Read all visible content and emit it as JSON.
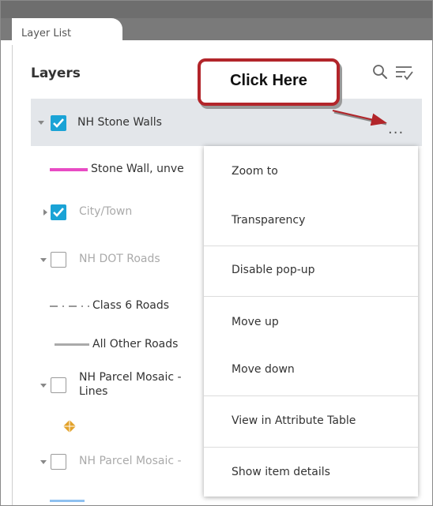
{
  "tab": {
    "label": "Layer List"
  },
  "header": {
    "title": "Layers"
  },
  "callout": {
    "text": "Click Here"
  },
  "layers": [
    {
      "label": "NH Stone Walls",
      "checked": true
    },
    {
      "legend": "Stone Wall, unve"
    },
    {
      "label": "City/Town",
      "checked": true
    },
    {
      "label": "NH DOT Roads",
      "checked": false
    },
    {
      "legend": "Class 6 Roads"
    },
    {
      "legend": "All Other Roads"
    },
    {
      "label_line1": "NH Parcel Mosaic -",
      "label_line2": "Lines",
      "checked": false
    },
    {
      "label": "NH Parcel Mosaic -",
      "checked": false
    }
  ],
  "more_label": "...",
  "menu": {
    "items": [
      "Zoom to",
      "Transparency",
      "Disable pop-up",
      "Move up",
      "Move down",
      "View in Attribute Table",
      "Show item details"
    ]
  },
  "colors": {
    "accent": "#1aa3d6",
    "callout_border": "#b2252a",
    "stone_wall_line": "#e84bc4",
    "parcel_symbol": "#e3a22a",
    "last_symbol": "#8fc1f0"
  }
}
